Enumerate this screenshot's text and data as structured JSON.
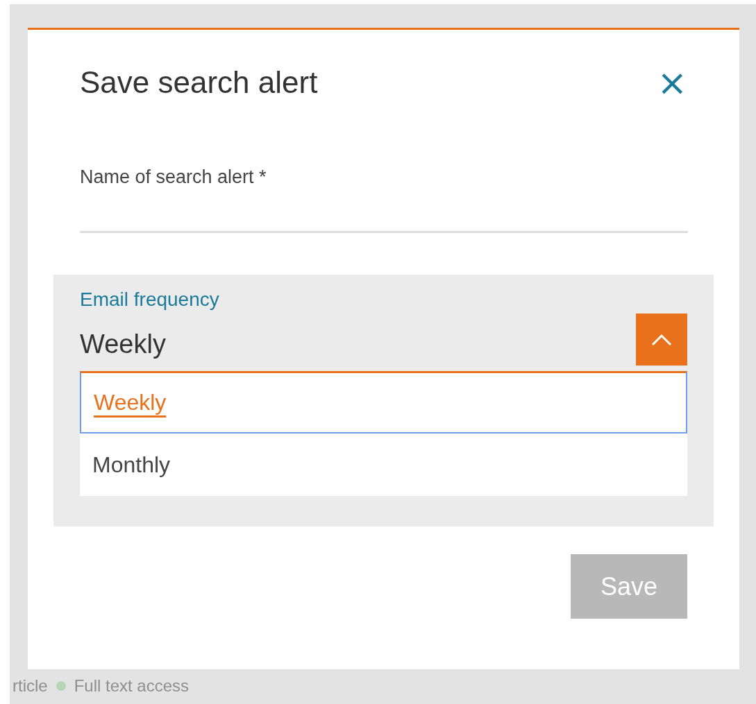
{
  "background": {
    "bottom_line": {
      "type_label": "rticle",
      "access": "Full text access"
    }
  },
  "dialog": {
    "title": "Save search alert",
    "close": "×",
    "name_field": {
      "label": "Name of search alert *"
    },
    "frequency": {
      "label": "Email frequency",
      "value": "Weekly",
      "expanded": true,
      "options": [
        {
          "label": "Weekly",
          "selected": true
        },
        {
          "label": "Monthly",
          "selected": false
        }
      ]
    },
    "save_button": {
      "label": "Save",
      "disabled": true
    }
  }
}
